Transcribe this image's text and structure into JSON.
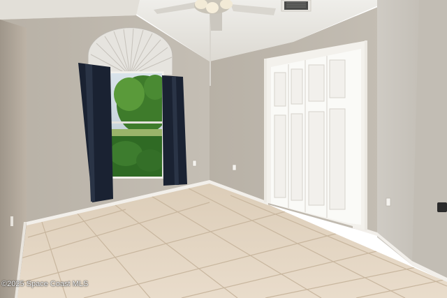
{
  "watermark": {
    "text": "©2025 Space Coast MLS"
  },
  "colors": {
    "wall_left": "#b7ada0",
    "wall_back": "#bdb6ab",
    "wall_right": "#c9c5bd",
    "ceiling": "#e9e7e2",
    "floor": "#e4d6c3",
    "grout": "#c9b79f",
    "door": "#f7f6f2",
    "curtain": "#1b2433",
    "baseboard": "#f4f2ee",
    "foliage": "#3f7d2c"
  },
  "objects": [
    "ceiling-fan",
    "air-vent",
    "arched-window",
    "fan-shade",
    "curtains",
    "bifold-closet-doors",
    "outlets",
    "tile-floor"
  ]
}
